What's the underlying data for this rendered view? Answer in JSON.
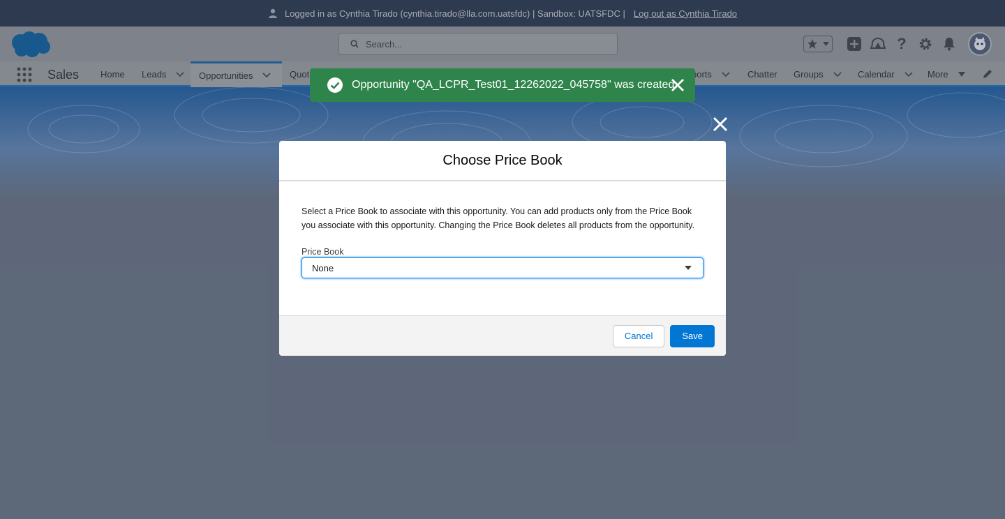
{
  "login_banner": {
    "text": "Logged in as Cynthia Tirado (cynthia.tirado@lla.com.uatsfdc) | Sandbox: UATSFDC |",
    "logout_link": "Log out as Cynthia Tirado"
  },
  "header": {
    "search_placeholder": "Search..."
  },
  "nav": {
    "app_name": "Sales",
    "items": [
      {
        "label": "Home",
        "has_menu": false
      },
      {
        "label": "Leads",
        "has_menu": true
      },
      {
        "label": "Opportunities",
        "has_menu": true,
        "active": true
      },
      {
        "label": "Quot",
        "has_menu": false
      },
      {
        "label": "ports",
        "has_menu": true
      },
      {
        "label": "Chatter",
        "has_menu": false
      },
      {
        "label": "Groups",
        "has_menu": true
      },
      {
        "label": "Calendar",
        "has_menu": true
      },
      {
        "label": "More",
        "has_menu": true
      }
    ]
  },
  "toast": {
    "message": "Opportunity \"QA_LCPR_Test01_12262022_045758\" was created.",
    "variant": "success"
  },
  "modal": {
    "title": "Choose Price Book",
    "description": "Select a Price Book to associate with this opportunity. You can add products only from the Price Book you associate with this opportunity. Changing the Price Book deletes all products from the opportunity.",
    "field_label": "Price Book",
    "selected_value": "None",
    "cancel_label": "Cancel",
    "save_label": "Save"
  },
  "colors": {
    "brand": "#0176d3",
    "success": "#2e844a",
    "backdrop": "#626d7e"
  }
}
